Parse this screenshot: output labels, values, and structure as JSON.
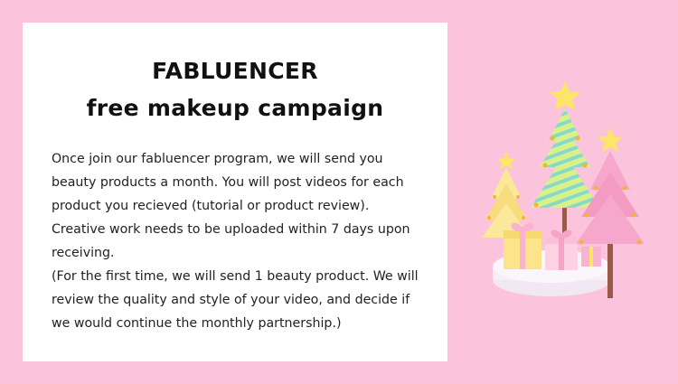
{
  "card": {
    "title_line1": "FABLUENCER",
    "title_line2": "free makeup campaign",
    "paragraph1": "Once join our fabluencer program, we will send you beauty products a month. You will post videos for each product you recieved (tutorial or product review). Creative work needs to be uploaded within 7 days upon receiving.",
    "paragraph2": "(For the first time, we will send 1 beauty product. We will review the quality and style of your video, and decide if we would continue the monthly partnership.)"
  },
  "illustration": {
    "icon": "christmas-trees-with-gifts-illustration"
  },
  "colors": {
    "background": "#fbc3dc",
    "card": "#ffffff",
    "text": "#222222"
  }
}
